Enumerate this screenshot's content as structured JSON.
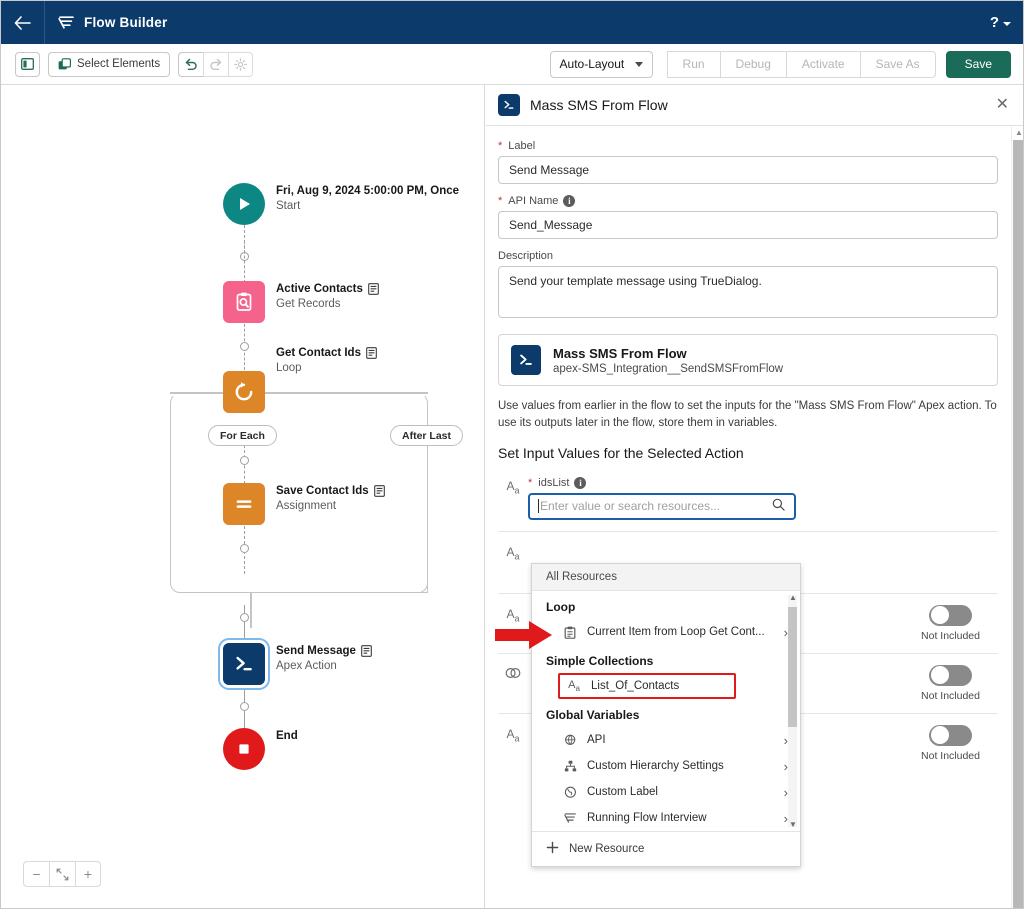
{
  "topbar": {
    "back_icon": "arrow-left-icon",
    "app_icon": "flow-builder-logo-icon",
    "title": "Flow Builder",
    "help_label": "?"
  },
  "toolbar": {
    "toggle_panel_icon": "left-panel-toggle-icon",
    "select_elements_label": "Select Elements",
    "select_elements_icon": "copy-elements-icon",
    "undo_icon": "undo-icon",
    "redo_icon": "redo-icon",
    "settings_icon": "gear-icon",
    "layout_value": "Auto-Layout",
    "run_label": "Run",
    "debug_label": "Debug",
    "activate_label": "Activate",
    "save_as_label": "Save As",
    "save_label": "Save",
    "save_color": "#1a6b57"
  },
  "canvas": {
    "zoom_out_label": "−",
    "zoom_fit_label": "fit-screen-icon",
    "zoom_in_label": "+",
    "nodes": [
      {
        "title": "Fri, Aug 9, 2024 5:00:00 PM, Once",
        "subtitle": "Start",
        "icon": "play-icon",
        "color": "#0d8784"
      },
      {
        "title": "Active Contacts",
        "subtitle": "Get Records",
        "icon": "get-records-icon",
        "color": "#f5628b"
      },
      {
        "title": "Get Contact Ids",
        "subtitle": "Loop",
        "icon": "loop-icon",
        "color": "#dd8628"
      },
      {
        "title": "Save Contact Ids",
        "subtitle": "Assignment",
        "icon": "assignment-icon",
        "color": "#dd8628"
      },
      {
        "title": "Send Message",
        "subtitle": "Apex Action",
        "icon": "apex-action-icon",
        "color": "#0b3a6b"
      },
      {
        "title": "End",
        "subtitle": "",
        "icon": "end-icon",
        "color": "#e01a1a"
      }
    ],
    "branch_for_each": "For Each",
    "branch_after_last": "After Last"
  },
  "panel": {
    "icon": "apex-action-icon",
    "title": "Mass SMS From Flow",
    "close_icon": "close-icon",
    "label_field": {
      "label": "Label",
      "value": "Send Message",
      "required": true
    },
    "api_name_field": {
      "label": "API Name",
      "value": "Send_Message",
      "required": true,
      "info_icon": "info-icon"
    },
    "description_field": {
      "label": "Description",
      "value": "Send your template message using TrueDialog."
    },
    "action_card": {
      "name": "Mass SMS From Flow",
      "api": "apex-SMS_Integration__SendSMSFromFlow",
      "icon": "apex-action-icon"
    },
    "help_text": "Use values from earlier in the flow to set the inputs for the \"Mass SMS From Flow\" Apex action. To use its outputs later in the flow, store them in variables.",
    "section_title": "Set Input Values for the Selected Action",
    "input_rows": [
      {
        "icon": "text-type-icon",
        "label": "idsList",
        "required": true,
        "info_icon": "info-icon",
        "has_search": true
      },
      {
        "icon": "text-type-icon",
        "label": "",
        "toggle_label": "",
        "has_toggle": false
      },
      {
        "icon": "text-type-icon",
        "label": "",
        "toggle_label": "Not Included",
        "has_toggle": true
      },
      {
        "icon": "boolean-type-icon",
        "label": "",
        "toggle_label": "Not Included",
        "has_toggle": true
      },
      {
        "icon": "text-type-icon",
        "label": "",
        "toggle_label": "Not Included",
        "has_toggle": true
      }
    ],
    "search": {
      "placeholder": "Enter value or search resources...",
      "value": "",
      "search_icon": "search-icon",
      "focus_color": "#1b5faa"
    }
  },
  "dropdown": {
    "header": "All Resources",
    "groups": [
      {
        "title": "Loop",
        "items": [
          {
            "label": "Current Item from Loop Get Cont...",
            "icon": "record-variable-icon",
            "chevron": "›",
            "highlighted": false
          }
        ]
      },
      {
        "title": "Simple Collections",
        "items": [
          {
            "label": "List_Of_Contacts",
            "icon": "text-type-icon",
            "chevron": "",
            "highlighted": true
          }
        ]
      },
      {
        "title": "Global Variables",
        "items": [
          {
            "label": "API",
            "icon": "api-globe-icon",
            "chevron": "›",
            "highlighted": false
          },
          {
            "label": "Custom Hierarchy Settings",
            "icon": "hierarchy-icon",
            "chevron": "›",
            "highlighted": false
          },
          {
            "label": "Custom Label",
            "icon": "globe-icon",
            "chevron": "›",
            "highlighted": false
          },
          {
            "label": "Running Flow Interview",
            "icon": "flow-icon",
            "chevron": "›",
            "highlighted": false
          }
        ]
      }
    ],
    "new_resource_label": "New Resource",
    "new_resource_icon": "plus-icon"
  },
  "annotation": {
    "arrow_icon": "red-arrow-right",
    "arrow_color": "#e01a1a",
    "highlight_color": "#e01a1a"
  }
}
